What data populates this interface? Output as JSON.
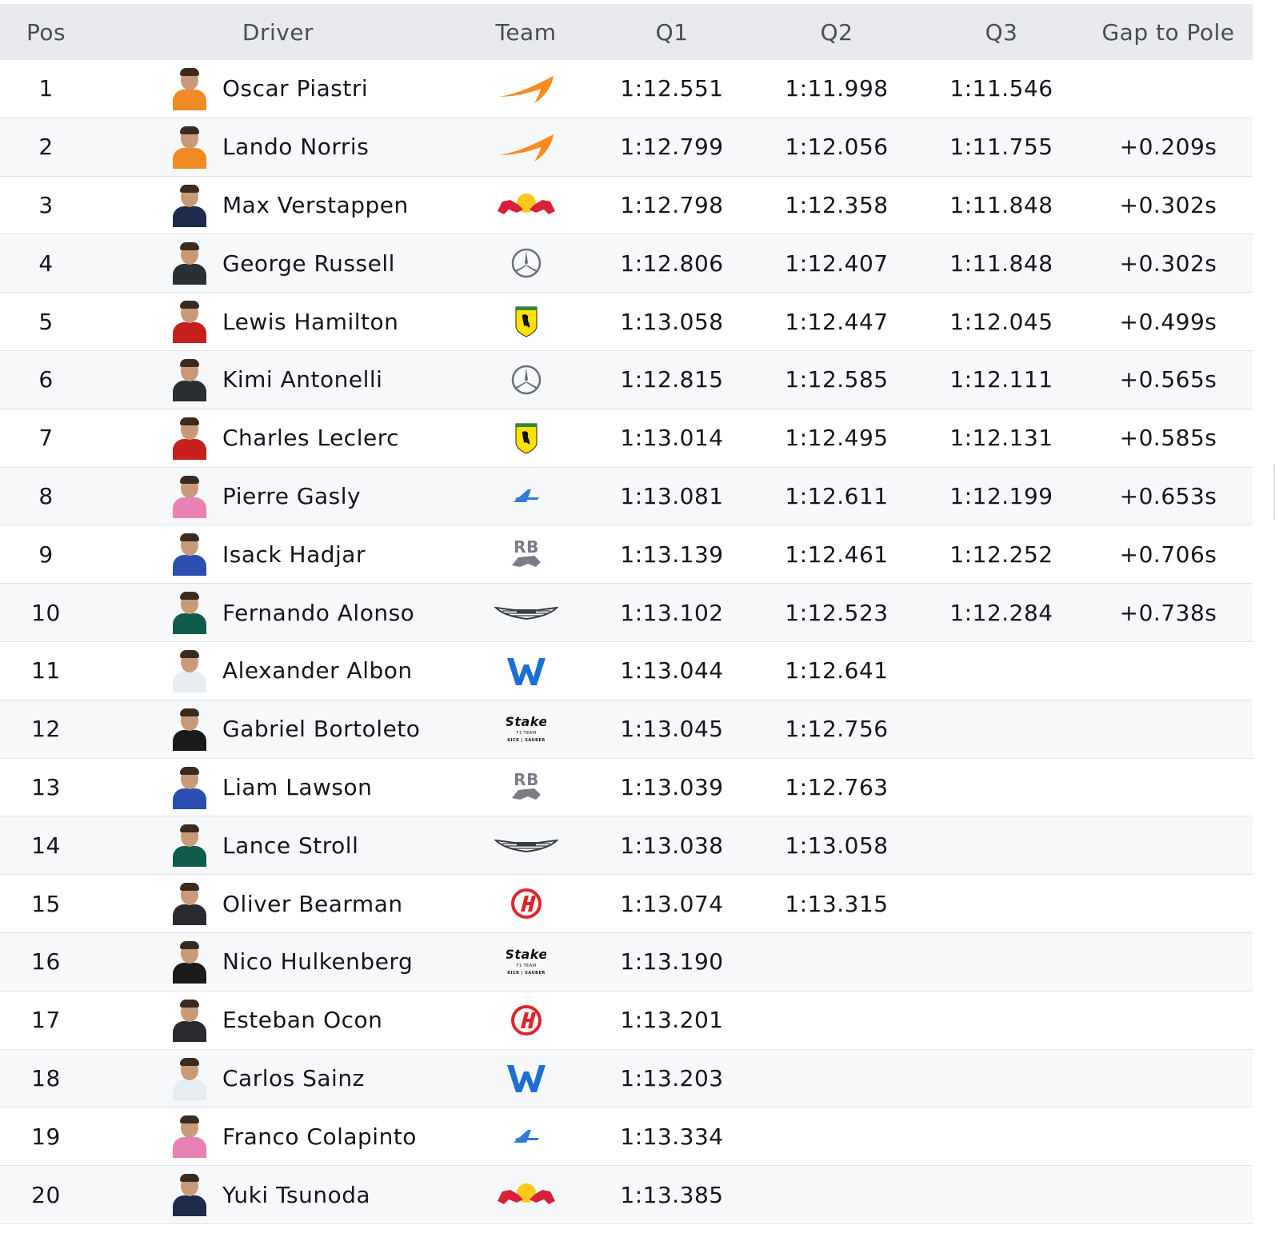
{
  "header": {
    "pos": "Pos",
    "driver": "Driver",
    "team": "Team",
    "q1": "Q1",
    "q2": "Q2",
    "q3": "Q3",
    "gap": "Gap to Pole"
  },
  "rows": [
    {
      "pos": "1",
      "driver": "Oscar Piastri",
      "team_icon": "mclaren-logo-icon",
      "suit": "#f08a24",
      "q1": "1:12.551",
      "q2": "1:11.998",
      "q3": "1:11.546",
      "gap": ""
    },
    {
      "pos": "2",
      "driver": "Lando Norris",
      "team_icon": "mclaren-logo-icon",
      "suit": "#f08a24",
      "q1": "1:12.799",
      "q2": "1:12.056",
      "q3": "1:11.755",
      "gap": "+0.209s"
    },
    {
      "pos": "3",
      "driver": "Max Verstappen",
      "team_icon": "red-bull-logo-icon",
      "suit": "#1e2a4a",
      "q1": "1:12.798",
      "q2": "1:12.358",
      "q3": "1:11.848",
      "gap": "+0.302s"
    },
    {
      "pos": "4",
      "driver": "George Russell",
      "team_icon": "mercedes-logo-icon",
      "suit": "#2a2f33",
      "q1": "1:12.806",
      "q2": "1:12.407",
      "q3": "1:11.848",
      "gap": "+0.302s"
    },
    {
      "pos": "5",
      "driver": "Lewis Hamilton",
      "team_icon": "ferrari-logo-icon",
      "suit": "#c8201e",
      "q1": "1:13.058",
      "q2": "1:12.447",
      "q3": "1:12.045",
      "gap": "+0.499s"
    },
    {
      "pos": "6",
      "driver": "Kimi Antonelli",
      "team_icon": "mercedes-logo-icon",
      "suit": "#2a2f33",
      "q1": "1:12.815",
      "q2": "1:12.585",
      "q3": "1:12.111",
      "gap": "+0.565s"
    },
    {
      "pos": "7",
      "driver": "Charles Leclerc",
      "team_icon": "ferrari-logo-icon",
      "suit": "#c8201e",
      "q1": "1:13.014",
      "q2": "1:12.495",
      "q3": "1:12.131",
      "gap": "+0.585s"
    },
    {
      "pos": "8",
      "driver": "Pierre Gasly",
      "team_icon": "alpine-logo-icon",
      "suit": "#e882b4",
      "q1": "1:13.081",
      "q2": "1:12.611",
      "q3": "1:12.199",
      "gap": "+0.653s"
    },
    {
      "pos": "9",
      "driver": "Isack Hadjar",
      "team_icon": "racing-bulls-logo-icon",
      "suit": "#2b4fb0",
      "q1": "1:13.139",
      "q2": "1:12.461",
      "q3": "1:12.252",
      "gap": "+0.706s"
    },
    {
      "pos": "10",
      "driver": "Fernando Alonso",
      "team_icon": "aston-martin-logo-icon",
      "suit": "#0f5c4c",
      "q1": "1:13.102",
      "q2": "1:12.523",
      "q3": "1:12.284",
      "gap": "+0.738s"
    },
    {
      "pos": "11",
      "driver": "Alexander Albon",
      "team_icon": "williams-logo-icon",
      "suit": "#e8edf4",
      "q1": "1:13.044",
      "q2": "1:12.641",
      "q3": "",
      "gap": ""
    },
    {
      "pos": "12",
      "driver": "Gabriel Bortoleto",
      "team_icon": "stake-sauber-logo-icon",
      "suit": "#1a1a1a",
      "q1": "1:13.045",
      "q2": "1:12.756",
      "q3": "",
      "gap": ""
    },
    {
      "pos": "13",
      "driver": "Liam Lawson",
      "team_icon": "racing-bulls-logo-icon",
      "suit": "#2b4fb0",
      "q1": "1:13.039",
      "q2": "1:12.763",
      "q3": "",
      "gap": ""
    },
    {
      "pos": "14",
      "driver": "Lance Stroll",
      "team_icon": "aston-martin-logo-icon",
      "suit": "#0f5c4c",
      "q1": "1:13.038",
      "q2": "1:13.058",
      "q3": "",
      "gap": ""
    },
    {
      "pos": "15",
      "driver": "Oliver Bearman",
      "team_icon": "haas-logo-icon",
      "suit": "#2a2a2e",
      "q1": "1:13.074",
      "q2": "1:13.315",
      "q3": "",
      "gap": ""
    },
    {
      "pos": "16",
      "driver": "Nico Hulkenberg",
      "team_icon": "stake-sauber-logo-icon",
      "suit": "#1a1a1a",
      "q1": "1:13.190",
      "q2": "",
      "q3": "",
      "gap": ""
    },
    {
      "pos": "17",
      "driver": "Esteban Ocon",
      "team_icon": "haas-logo-icon",
      "suit": "#2a2a2e",
      "q1": "1:13.201",
      "q2": "",
      "q3": "",
      "gap": ""
    },
    {
      "pos": "18",
      "driver": "Carlos Sainz",
      "team_icon": "williams-logo-icon",
      "suit": "#e8edf4",
      "q1": "1:13.203",
      "q2": "",
      "q3": "",
      "gap": ""
    },
    {
      "pos": "19",
      "driver": "Franco Colapinto",
      "team_icon": "alpine-logo-icon",
      "suit": "#e882b4",
      "q1": "1:13.334",
      "q2": "",
      "q3": "",
      "gap": ""
    },
    {
      "pos": "20",
      "driver": "Yuki Tsunoda",
      "team_icon": "red-bull-logo-icon",
      "suit": "#1e2a4a",
      "q1": "1:13.385",
      "q2": "",
      "q3": "",
      "gap": ""
    }
  ],
  "logo_text": {
    "stake": "Stake",
    "stake_sub": "F1 TEAM",
    "stake_sub2": "KICK | SAUBER",
    "rb": "RB"
  },
  "colors": {
    "mclaren": "#ff8a1e",
    "ferrari": "#ffe000",
    "alpine": "#2f7bd9",
    "williams": "#1c6fd3",
    "haas": "#e0242a",
    "redbull_red": "#d8203a",
    "redbull_yellow": "#ffc81e"
  }
}
